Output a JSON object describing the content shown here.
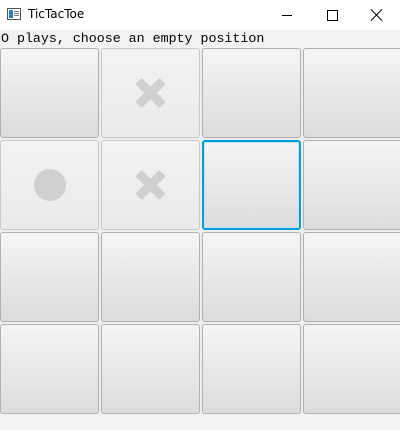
{
  "window": {
    "title": "TicTacToe",
    "icon": "java-window-icon",
    "controls": [
      "minimize-icon",
      "maximize-icon",
      "close-icon"
    ]
  },
  "status": {
    "text": "O plays, choose an empty position"
  },
  "board": {
    "rows": 4,
    "cols": 4,
    "cells": [
      "",
      "X",
      "",
      "",
      "O",
      "X",
      "",
      "",
      "",
      "",
      "",
      "",
      "",
      "",
      "",
      ""
    ],
    "focused_index": 6
  },
  "colors": {
    "mark": "#d0d0d0",
    "focus": "#039ed3",
    "cell_top": "#f5f5f5",
    "cell_bottom": "#dcdcdc"
  }
}
